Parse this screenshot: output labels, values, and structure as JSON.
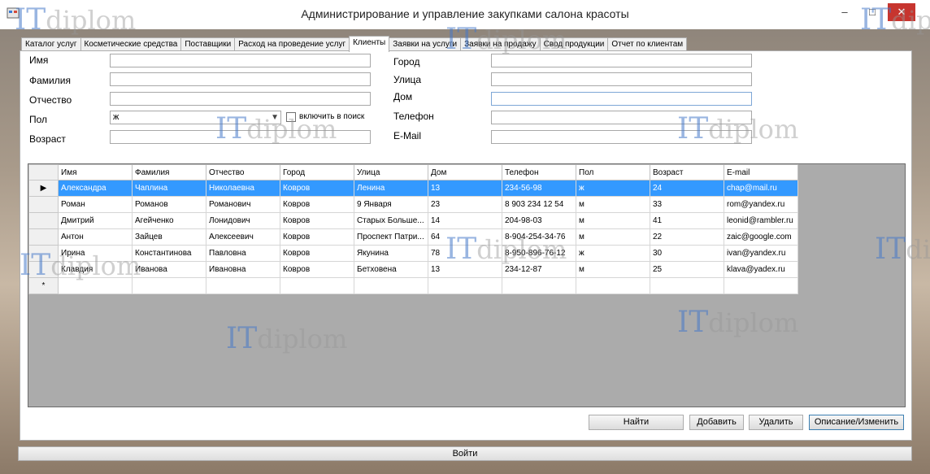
{
  "window": {
    "title": "Администрирование и управление закупками салона красоты",
    "minimize": "–",
    "maximize": "□",
    "close": "✕"
  },
  "tabs": [
    {
      "label": "Каталог услуг"
    },
    {
      "label": "Косметические средства"
    },
    {
      "label": "Поставщики"
    },
    {
      "label": "Расход на проведение услуг"
    },
    {
      "label": "Клиенты",
      "active": true
    },
    {
      "label": "Заявки на услуги"
    },
    {
      "label": "Заявки на продажу"
    },
    {
      "label": "Свод продукции"
    },
    {
      "label": "Отчет по клиентам"
    }
  ],
  "form": {
    "name_label": "Имя",
    "name_value": "",
    "surname_label": "Фамилия",
    "surname_value": "",
    "patronymic_label": "Отчество",
    "patronymic_value": "",
    "gender_label": "Пол",
    "gender_value": "ж",
    "include_search_label": "включить в поиск",
    "age_label": "Возраст",
    "age_value": "",
    "city_label": "Город",
    "city_value": "",
    "street_label": "Улица",
    "street_value": "",
    "house_label": "Дом",
    "house_value": "",
    "phone_label": "Телефон",
    "phone_value": "",
    "email_label": "E-Mail",
    "email_value": ""
  },
  "grid": {
    "columns": [
      "Имя",
      "Фамилия",
      "Отчество",
      "Город",
      "Улица",
      "Дом",
      "Телефон",
      "Пол",
      "Возраст",
      "E-mail"
    ],
    "rows": [
      [
        "Александра",
        "Чаплина",
        "Николаевна",
        "Ковров",
        "Ленина",
        "13",
        "234-56-98",
        "ж",
        "24",
        "chap@mail.ru"
      ],
      [
        "Роман",
        "Романов",
        "Романович",
        "Ковров",
        "9 Января",
        "23",
        "8 903 234 12 54",
        "м",
        "33",
        "rom@yandex.ru"
      ],
      [
        "Дмитрий",
        "Агейченко",
        "Лонидович",
        "Ковров",
        "Старых Больше...",
        "14",
        "204-98-03",
        "м",
        "41",
        "leonid@rambler.ru"
      ],
      [
        "Антон",
        "Зайцев",
        " Алексеевич",
        "Ковров",
        "Проспект Патри...",
        "64",
        "8-904-254-34-76",
        "м",
        "22",
        "zaic@google.com"
      ],
      [
        "Ирина",
        "Константинова",
        "Павловна",
        "Ковров",
        "Якунина",
        "78",
        "8-950-896-76-12",
        "ж",
        "30",
        "ivan@yandex.ru"
      ],
      [
        "Клавдия",
        "Иванова",
        "Ивановна",
        "Ковров",
        "Бетховена",
        "13",
        "234-12-87",
        "м",
        "25",
        "klava@yadex.ru"
      ]
    ],
    "selected_row": 0,
    "current_row_marker": "▶",
    "new_row_marker": "*"
  },
  "buttons": {
    "find": "Найти",
    "add": "Добавить",
    "delete": "Удалить",
    "describe": "Описание/Изменить",
    "login": "Войти"
  },
  "watermark": {
    "it": "IT",
    "diplom": "diplom"
  }
}
